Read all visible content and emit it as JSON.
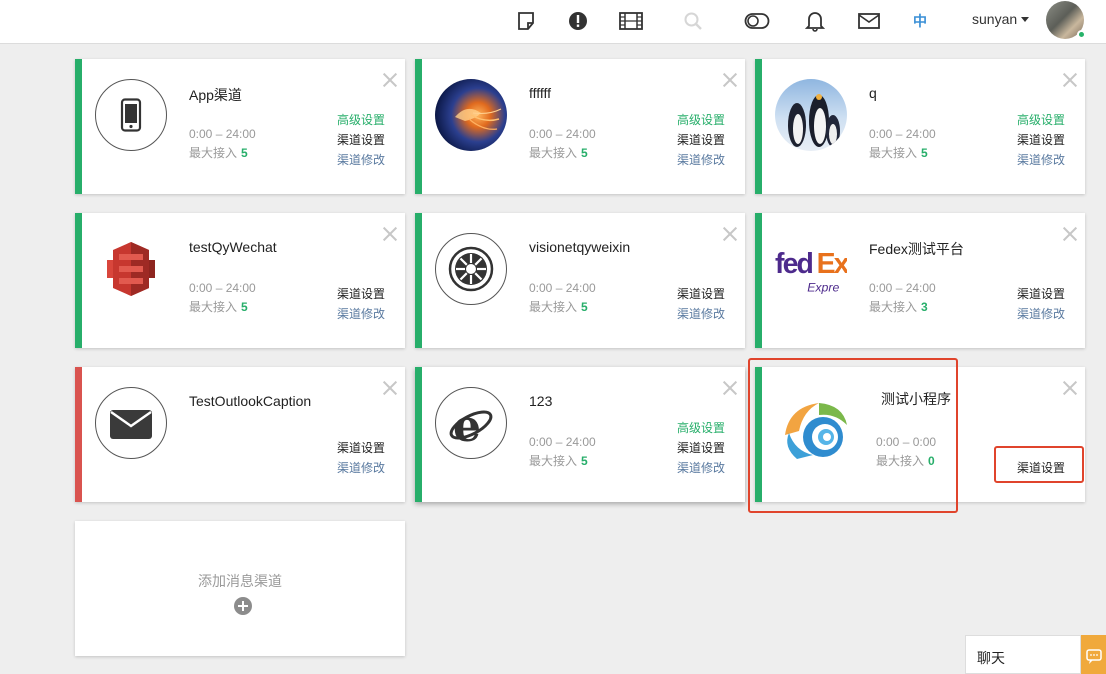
{
  "header": {
    "lang": "中",
    "username": "sunyan",
    "icons": [
      "note-icon",
      "alert-icon",
      "film-icon",
      "search-icon",
      "toggle-icon",
      "bell-icon",
      "mail-icon"
    ]
  },
  "cards": [
    {
      "name": "App渠道",
      "time": "0:00 – 24:00",
      "max_label": "最大接入",
      "max_value": "5",
      "links": [
        "高级设置",
        "渠道设置",
        "渠道修改"
      ],
      "status": "active"
    },
    {
      "name": "ffffff",
      "time": "0:00 – 24:00",
      "max_label": "最大接入",
      "max_value": "5",
      "links": [
        "高级设置",
        "渠道设置",
        "渠道修改"
      ],
      "status": "active"
    },
    {
      "name": "q",
      "time": "0:00 – 24:00",
      "max_label": "最大接入",
      "max_value": "5",
      "links": [
        "高级设置",
        "渠道设置",
        "渠道修改"
      ],
      "status": "active"
    },
    {
      "name": "testQyWechat",
      "time": "0:00 – 24:00",
      "max_label": "最大接入",
      "max_value": "5",
      "links": [
        "渠道设置",
        "渠道修改"
      ],
      "status": "active"
    },
    {
      "name": "visionetqyweixin",
      "time": "0:00 – 24:00",
      "max_label": "最大接入",
      "max_value": "5",
      "links": [
        "渠道设置",
        "渠道修改"
      ],
      "status": "active"
    },
    {
      "name": "Fedex测试平台",
      "time": "0:00 – 24:00",
      "max_label": "最大接入",
      "max_value": "3",
      "links": [
        "渠道设置",
        "渠道修改"
      ],
      "status": "active"
    },
    {
      "name": "TestOutlookCaption",
      "links": [
        "渠道设置",
        "渠道修改"
      ],
      "status": "inactive"
    },
    {
      "name": "123",
      "time": "0:00 – 24:00",
      "max_label": "最大接入",
      "max_value": "5",
      "links": [
        "高级设置",
        "渠道设置",
        "渠道修改"
      ],
      "status": "active"
    },
    {
      "name": "测试小程序",
      "time": "0:00 – 0:00",
      "max_label": "最大接入",
      "max_value": "0",
      "links": [
        "渠道设置"
      ],
      "status": "active"
    }
  ],
  "add_card": {
    "label": "添加消息渠道"
  },
  "chat": {
    "label": "聊天"
  },
  "colors": {
    "active": "#27ae6a",
    "inactive": "#d9534f",
    "highlight": "#e0442c",
    "lang": "#3a8fd6"
  }
}
